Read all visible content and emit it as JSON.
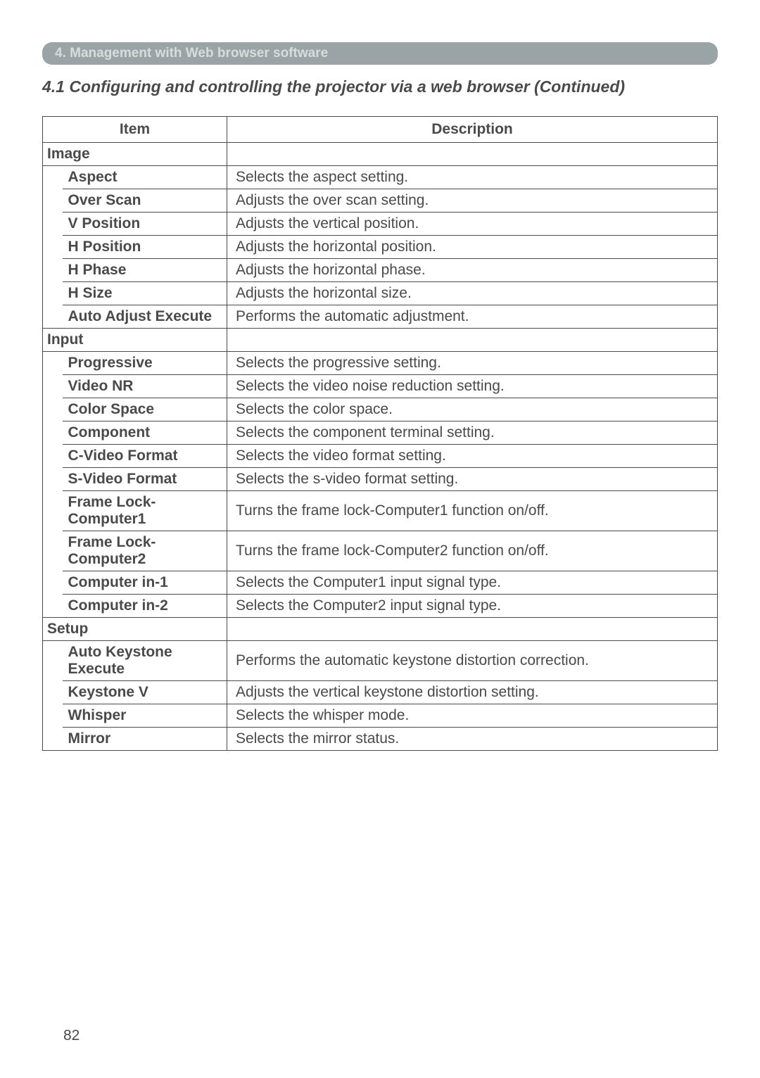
{
  "chapter_bar": "4. Management with Web browser software",
  "section_title": "4.1 Configuring and controlling the projector via a web browser (Continued)",
  "headers": {
    "item": "Item",
    "description": "Description"
  },
  "groups": [
    {
      "category": "Image",
      "rows": [
        {
          "item": "Aspect",
          "desc": "Selects the aspect setting."
        },
        {
          "item": "Over Scan",
          "desc": "Adjusts the over scan setting."
        },
        {
          "item": "V Position",
          "desc": "Adjusts the vertical position."
        },
        {
          "item": "H Position",
          "desc": "Adjusts the horizontal position."
        },
        {
          "item": "H Phase",
          "desc": "Adjusts the horizontal phase."
        },
        {
          "item": "H Size",
          "desc": "Adjusts the horizontal size."
        },
        {
          "item": "Auto Adjust Execute",
          "desc": "Performs the automatic adjustment."
        }
      ]
    },
    {
      "category": "Input",
      "rows": [
        {
          "item": "Progressive",
          "desc": "Selects the progressive setting."
        },
        {
          "item": "Video NR",
          "desc": "Selects the video noise reduction setting."
        },
        {
          "item": "Color Space",
          "desc": "Selects the color space."
        },
        {
          "item": "Component",
          "desc": "Selects the component terminal setting."
        },
        {
          "item": "C-Video Format",
          "desc": "Selects the video format setting."
        },
        {
          "item": "S-Video Format",
          "desc": "Selects the s-video format setting."
        },
        {
          "item": "Frame Lock-Computer1",
          "desc": "Turns the frame lock-Computer1 function on/off."
        },
        {
          "item": "Frame Lock-Computer2",
          "desc": "Turns the frame lock-Computer2 function on/off."
        },
        {
          "item": "Computer in-1",
          "desc": "Selects the Computer1 input signal type."
        },
        {
          "item": "Computer in-2",
          "desc": "Selects the Computer2 input signal type."
        }
      ]
    },
    {
      "category": "Setup",
      "rows": [
        {
          "item": "Auto Keystone Execute",
          "desc": "Performs the automatic keystone distortion correction."
        },
        {
          "item": "Keystone V",
          "desc": "Adjusts the vertical keystone distortion setting."
        },
        {
          "item": "Whisper",
          "desc": "Selects the whisper mode."
        },
        {
          "item": "Mirror",
          "desc": "Selects the mirror status."
        }
      ]
    }
  ],
  "page_number": "82"
}
